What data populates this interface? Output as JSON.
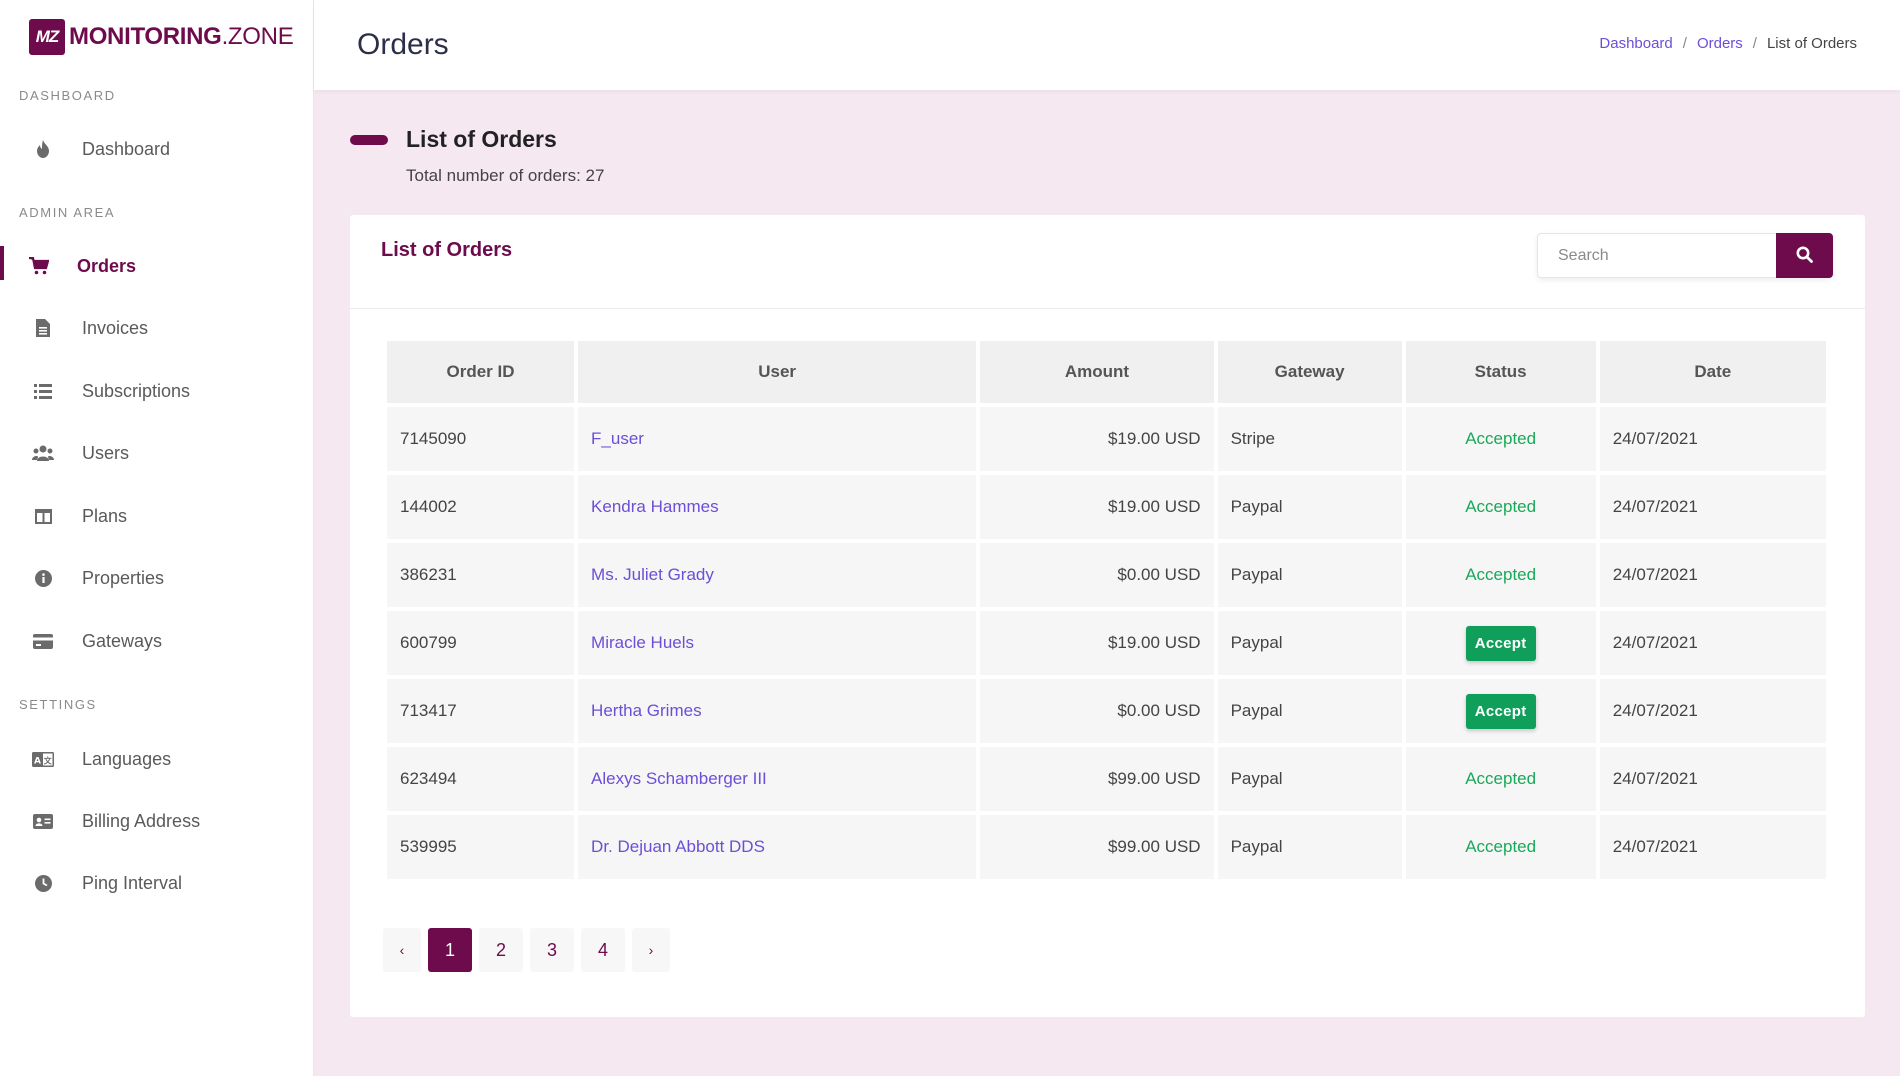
{
  "brand": {
    "mark": "MZ",
    "name_bold": "MONITORING",
    "name_light": ".ZONE"
  },
  "sidebar": {
    "sections": [
      {
        "label": "DASHBOARD"
      },
      {
        "label": "ADMIN AREA"
      },
      {
        "label": "SETTINGS"
      }
    ],
    "items": [
      {
        "label": "Dashboard",
        "icon": "fire-icon"
      },
      {
        "label": "Orders",
        "icon": "cart-icon",
        "active": true
      },
      {
        "label": "Invoices",
        "icon": "file-icon"
      },
      {
        "label": "Subscriptions",
        "icon": "list-icon"
      },
      {
        "label": "Users",
        "icon": "users-icon"
      },
      {
        "label": "Plans",
        "icon": "columns-icon"
      },
      {
        "label": "Properties",
        "icon": "info-icon"
      },
      {
        "label": "Gateways",
        "icon": "credit-card-icon"
      },
      {
        "label": "Languages",
        "icon": "language-icon"
      },
      {
        "label": "Billing Address",
        "icon": "address-card-icon"
      },
      {
        "label": "Ping Interval",
        "icon": "clock-icon"
      }
    ]
  },
  "header": {
    "title": "Orders",
    "breadcrumb": [
      "Dashboard",
      "Orders",
      "List of Orders"
    ]
  },
  "section": {
    "title": "List of Orders",
    "subtitle": "Total number of orders: 27"
  },
  "card": {
    "title": "List of Orders",
    "search_placeholder": "Search"
  },
  "table": {
    "columns": [
      "Order ID",
      "User",
      "Amount",
      "Gateway",
      "Status",
      "Date"
    ],
    "rows": [
      {
        "id": "7145090",
        "user": "F_user",
        "amount": "$19.00 USD",
        "gateway": "Stripe",
        "status": "Accepted",
        "date": "24/07/2021"
      },
      {
        "id": "144002",
        "user": "Kendra Hammes",
        "amount": "$19.00 USD",
        "gateway": "Paypal",
        "status": "Accepted",
        "date": "24/07/2021"
      },
      {
        "id": "386231",
        "user": "Ms. Juliet Grady",
        "amount": "$0.00 USD",
        "gateway": "Paypal",
        "status": "Accepted",
        "date": "24/07/2021"
      },
      {
        "id": "600799",
        "user": "Miracle Huels",
        "amount": "$19.00 USD",
        "gateway": "Paypal",
        "status": "Accept",
        "date": "24/07/2021"
      },
      {
        "id": "713417",
        "user": "Hertha Grimes",
        "amount": "$0.00 USD",
        "gateway": "Paypal",
        "status": "Accept",
        "date": "24/07/2021"
      },
      {
        "id": "623494",
        "user": "Alexys Schamberger III",
        "amount": "$99.00 USD",
        "gateway": "Paypal",
        "status": "Accepted",
        "date": "24/07/2021"
      },
      {
        "id": "539995",
        "user": "Dr. Dejuan Abbott DDS",
        "amount": "$99.00 USD",
        "gateway": "Paypal",
        "status": "Accepted",
        "date": "24/07/2021"
      }
    ]
  },
  "pagination": {
    "prev": "‹",
    "next": "›",
    "pages": [
      "1",
      "2",
      "3",
      "4"
    ],
    "current": "1"
  },
  "colors": {
    "brand": "#6d0b4d",
    "link": "#6c4fd6",
    "success": "#1aa85a"
  }
}
